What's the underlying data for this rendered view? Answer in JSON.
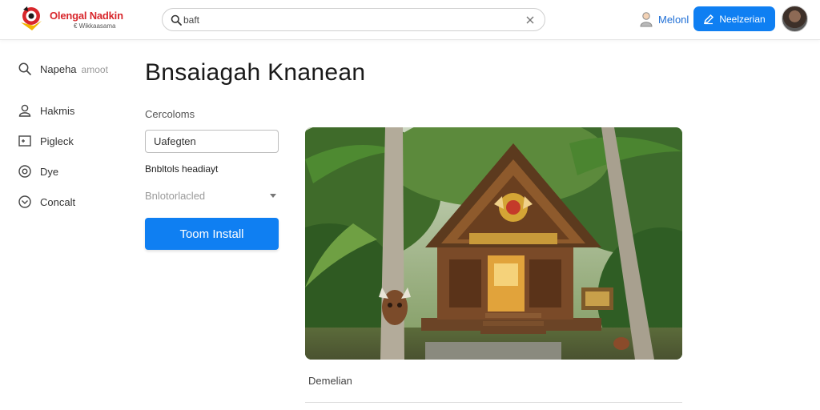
{
  "brand": {
    "title": "Olengal Nadkin",
    "subtitle": "€ Wikkaasama",
    "accent": "#d8262b"
  },
  "search": {
    "value": "baft",
    "icon": "search-icon",
    "clear_icon": "close-icon"
  },
  "header": {
    "profile_label": "Melonl",
    "primary_button_label": "Neelzerian",
    "primary_color": "#0f7ff2"
  },
  "sidebar": {
    "items": [
      {
        "label": "Napeha",
        "extra": "amoot",
        "icon": "search-icon"
      },
      {
        "label": "Hakmis",
        "icon": "user-icon"
      },
      {
        "label": "Pigleck",
        "icon": "image-icon"
      },
      {
        "label": "Dye",
        "icon": "at-sign-icon"
      },
      {
        "label": "Concalt",
        "icon": "chevron-circle-icon"
      }
    ]
  },
  "main": {
    "title": "Bnsaiagah Knanean",
    "field_label": "Cercoloms",
    "field_value": "Uafegten",
    "section_label": "Bnbltols headiayt",
    "select_value": "Bnlotorlacled",
    "install_label": "Toom Install",
    "caption": "Demelian"
  }
}
